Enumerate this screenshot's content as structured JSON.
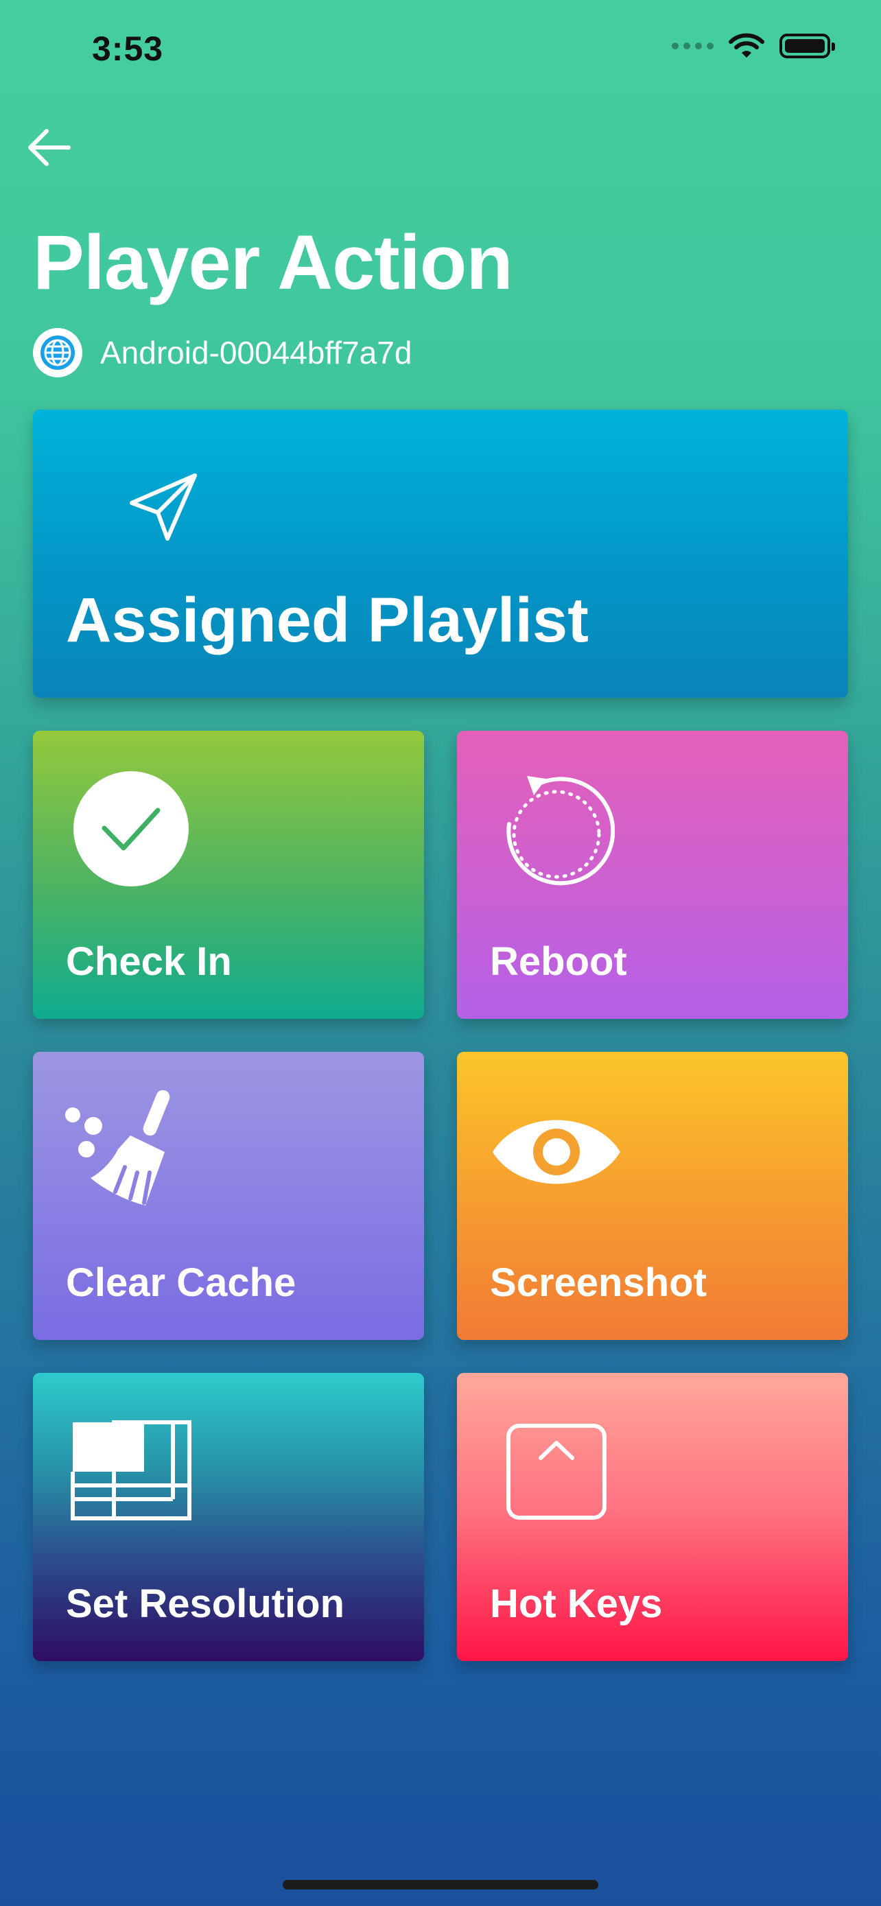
{
  "status_bar": {
    "time": "3:53"
  },
  "header": {
    "back_icon": "arrow-left-icon",
    "title": "Player Action",
    "device_icon": "globe-icon",
    "device_name": "Android-00044bff7a7d"
  },
  "actions": {
    "assigned_playlist": {
      "label": "Assigned Playlist",
      "icon": "paper-plane-icon"
    },
    "check_in": {
      "label": "Check In",
      "icon": "check-circle-icon"
    },
    "reboot": {
      "label": "Reboot",
      "icon": "refresh-icon"
    },
    "clear_cache": {
      "label": "Clear Cache",
      "icon": "broom-icon"
    },
    "screenshot": {
      "label": "Screenshot",
      "icon": "eye-icon"
    },
    "set_resolution": {
      "label": "Set Resolution",
      "icon": "resolution-icon"
    },
    "hot_keys": {
      "label": "Hot Keys",
      "icon": "caret-up-square-icon"
    }
  },
  "colors": {
    "background_top": "#45cf9f",
    "background_bottom": "#1a4f9c",
    "playlist": "#0396c7",
    "check_in": "#52b45f",
    "reboot": "#cb60d2",
    "clear_cache": "#8a7fe3",
    "screenshot": "#f7a22f",
    "set_resolution": "#2c4c8c",
    "hot_keys": "#ff6f80"
  }
}
